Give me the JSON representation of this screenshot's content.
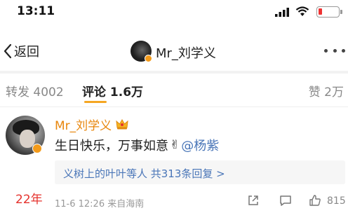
{
  "status_bar": {
    "time": "13:11"
  },
  "nav": {
    "back_label": "返回",
    "title": "Mr_刘学义"
  },
  "tabs": {
    "repost": "转发 4002",
    "comment": "评论 1.6万",
    "like": "赞 2万"
  },
  "comment": {
    "author": "Mr_刘学义",
    "text": "生日快乐，万事如意",
    "mention": "@杨紫",
    "replies_text": "义树上的叶叶等人 共313条回复 >",
    "year_label": "22年",
    "meta": "11-6 12:26 来自海南",
    "like_count": "815"
  },
  "colors": {
    "author": "#e8870e",
    "link": "#4a76b8",
    "accent": "#f5a623",
    "year_label": "#e5322d"
  },
  "icons": [
    "signal-icon",
    "wifi-icon",
    "battery-icon",
    "back-chevron-icon",
    "more-icon",
    "crown-icon",
    "victory-hand-icon",
    "share-icon",
    "comment-icon",
    "like-icon"
  ]
}
